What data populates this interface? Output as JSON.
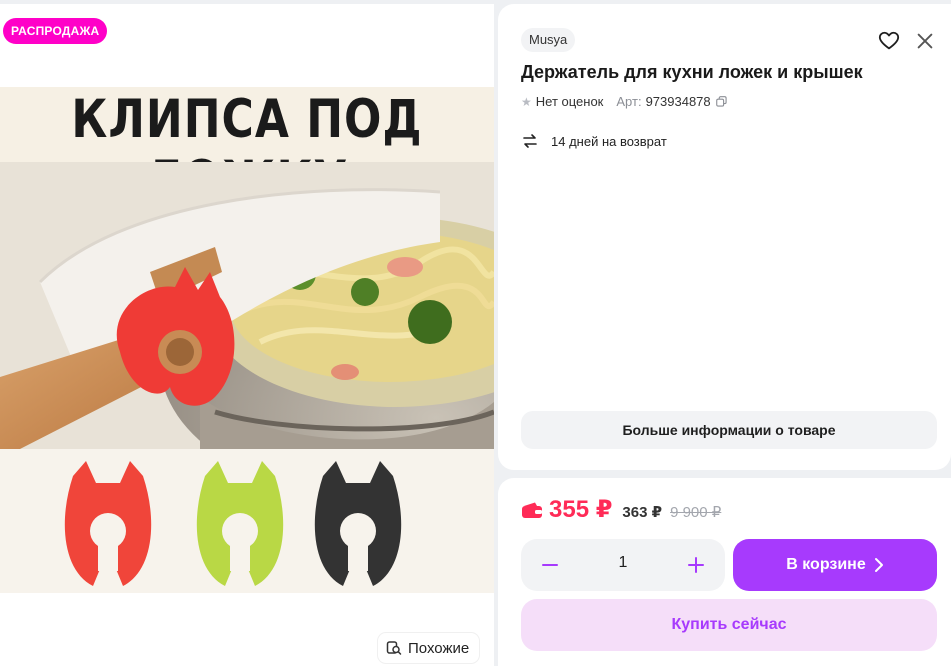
{
  "gallery": {
    "sale_badge": "РАСПРОДАЖА",
    "promo_title": "КЛИПСА ПОД ЛОЖКУ",
    "clip_colors": [
      "#f0453a",
      "#b9d845",
      "#333333"
    ],
    "similar_label": "Похожие"
  },
  "product": {
    "brand": "Musya",
    "title": "Держатель для кухни ложек и крышек",
    "rating_text": "Нет оценок",
    "article_label": "Арт:",
    "article": "973934878",
    "returns_text": "14 дней на возврат",
    "more_info_label": "Больше информации о товаре"
  },
  "purchase": {
    "price": "355 ₽",
    "wallet_price": "363 ₽",
    "original_price": "9 900 ₽",
    "quantity": "1",
    "cart_label": "В корзине",
    "buy_now_label": "Купить сейчас"
  },
  "colors": {
    "accent": "#a73afd",
    "price": "#ff2b57",
    "sale_badge": "#ff00c8"
  }
}
